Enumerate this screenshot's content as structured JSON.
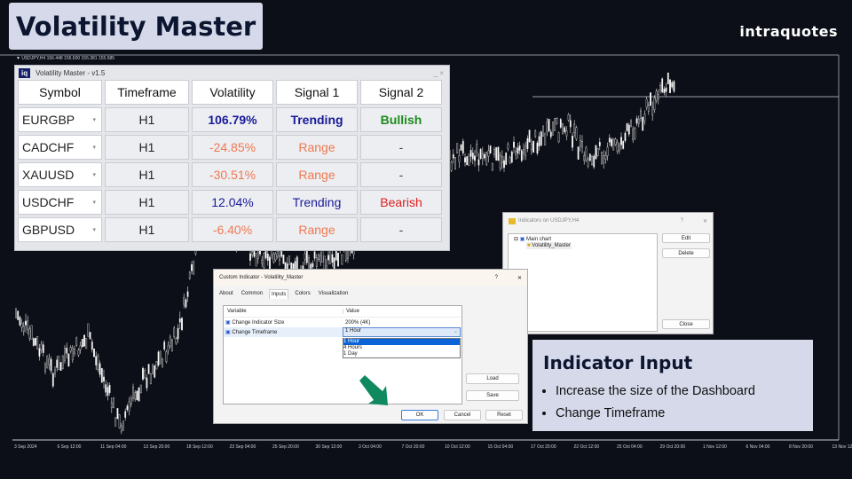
{
  "header": {
    "title": "Volatility Master",
    "brand": "intraquotes"
  },
  "chart": {
    "symbol_info": "▼ USDJPY,H4  156.448 156.600 155.381 155.585",
    "x_labels": [
      "3 Sep 2024",
      "6 Sep 12:00",
      "11 Sep 04:00",
      "13 Sep 20:00",
      "18 Sep 12:00",
      "23 Sep 04:00",
      "25 Sep 20:00",
      "30 Sep 12:00",
      "3 Oct 04:00",
      "7 Oct 20:00",
      "10 Oct 12:00",
      "15 Oct 04:00",
      "17 Oct 20:00",
      "22 Oct 12:00",
      "25 Oct 04:00",
      "29 Oct 20:00",
      "1 Nov 12:00",
      "6 Nov 04:00",
      "8 Nov 20:00",
      "13 Nov 12:00"
    ]
  },
  "dashboard": {
    "logo": "iq",
    "title": "Volatility Master - v1.5",
    "controls": "_ ×",
    "headers": [
      "Symbol",
      "Timeframe",
      "Volatility",
      "Signal 1",
      "Signal 2"
    ],
    "rows": [
      {
        "symbol": "EURGBP",
        "tf": "H1",
        "vol": "106.79%",
        "s1": "Trending",
        "s2": "Bullish",
        "vol_color": "#1a1a9a",
        "s1_color": "#1a1a9a",
        "s2_color": "#1e8a1e",
        "bold": true
      },
      {
        "symbol": "CADCHF",
        "tf": "H1",
        "vol": "-24.85%",
        "s1": "Range",
        "s2": "-",
        "vol_color": "#f07850",
        "s1_color": "#f07850",
        "s2_color": "#444"
      },
      {
        "symbol": "XAUUSD",
        "tf": "H1",
        "vol": "-30.51%",
        "s1": "Range",
        "s2": "-",
        "vol_color": "#f07850",
        "s1_color": "#f07850",
        "s2_color": "#444"
      },
      {
        "symbol": "USDCHF",
        "tf": "H1",
        "vol": "12.04%",
        "s1": "Trending",
        "s2": "Bearish",
        "vol_color": "#1a1a9a",
        "s1_color": "#1a1a9a",
        "s2_color": "#e02020"
      },
      {
        "symbol": "GBPUSD",
        "tf": "H1",
        "vol": "-6.40%",
        "s1": "Range",
        "s2": "-",
        "vol_color": "#f07850",
        "s1_color": "#f07850",
        "s2_color": "#444"
      }
    ]
  },
  "indicators_dialog": {
    "title": "Indicators on USDJPY,H4",
    "help": "?",
    "close": "✕",
    "tree_root": "Main chart",
    "tree_item": "Volatility_Master",
    "edit": "Edit",
    "delete": "Delete",
    "close_btn": "Close"
  },
  "custom_dialog": {
    "title": "Custom Indicator - Volatility_Master",
    "help": "?",
    "close": "✕",
    "tabs": [
      "About",
      "Common",
      "Inputs",
      "Colors",
      "Visualization"
    ],
    "active_tab": "Inputs",
    "col_variable": "Variable",
    "col_value": "Value",
    "params": [
      {
        "name": "Change Indicator Size",
        "value": "200% (4K)"
      },
      {
        "name": "Change Timeframe",
        "value": "1 Hour"
      }
    ],
    "options": [
      "1 Hour",
      "4 Hours",
      "1 Day"
    ],
    "load": "Load",
    "save": "Save",
    "ok": "OK",
    "cancel": "Cancel",
    "reset": "Reset"
  },
  "info": {
    "title": "Indicator Input",
    "bullets": [
      "Increase the size of the Dashboard",
      "Change Timeframe"
    ]
  },
  "colors": {
    "bull_candle": "#ffffff",
    "accent_arrow": "#0f8a5f"
  }
}
